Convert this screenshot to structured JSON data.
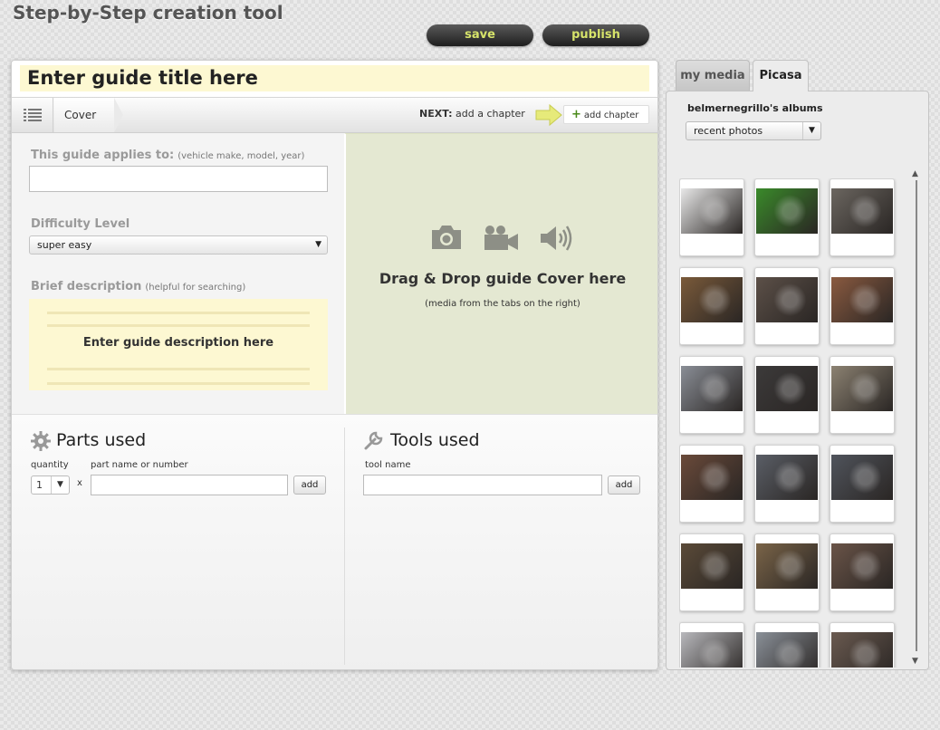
{
  "app": {
    "title": "Step-by-Step creation tool",
    "save_label": "save",
    "publish_label": "publish"
  },
  "guide": {
    "title_placeholder": "Enter guide title here",
    "chapter_tab": "Cover",
    "next_prefix": "NEXT:",
    "next_text": "add a chapter",
    "add_chapter_label": "add chapter"
  },
  "details": {
    "applies_label": "This guide applies to:",
    "applies_hint": "(vehicle make, model, year)",
    "applies_value": "",
    "difficulty_label": "Difficulty Level",
    "difficulty_value": "super easy",
    "description_label": "Brief description",
    "description_hint": "(helpful for searching)",
    "description_placeholder": "Enter guide description here"
  },
  "cover_drop": {
    "title": "Drag & Drop guide Cover here",
    "subtitle": "(media from the tabs on the right)"
  },
  "parts": {
    "title": "Parts used",
    "quantity_label": "quantity",
    "quantity_value": "1",
    "multiplier": "x",
    "name_label": "part name or number",
    "add_label": "add"
  },
  "tools": {
    "title": "Tools used",
    "name_label": "tool name",
    "add_label": "add"
  },
  "media": {
    "tabs": [
      "my media",
      "Picasa"
    ],
    "active_tab": "Picasa",
    "albums_title": "belmernegrillo's albums",
    "album_selected": "recent photos",
    "photo_colors": [
      [
        "#e8e8e8",
        "#3a8a2a",
        "#6b6660"
      ],
      [
        "#7a5a3a",
        "#5c5048",
        "#8a5a40"
      ],
      [
        "#8a8e96",
        "#3c3a3a",
        "#8c8272"
      ],
      [
        "#6a4a3a",
        "#5a5e66",
        "#50545c"
      ],
      [
        "#5a4a38",
        "#7a6448",
        "#6a5448"
      ],
      [
        "#b8b8bc",
        "#8a9098",
        "#6a5a50"
      ]
    ]
  }
}
